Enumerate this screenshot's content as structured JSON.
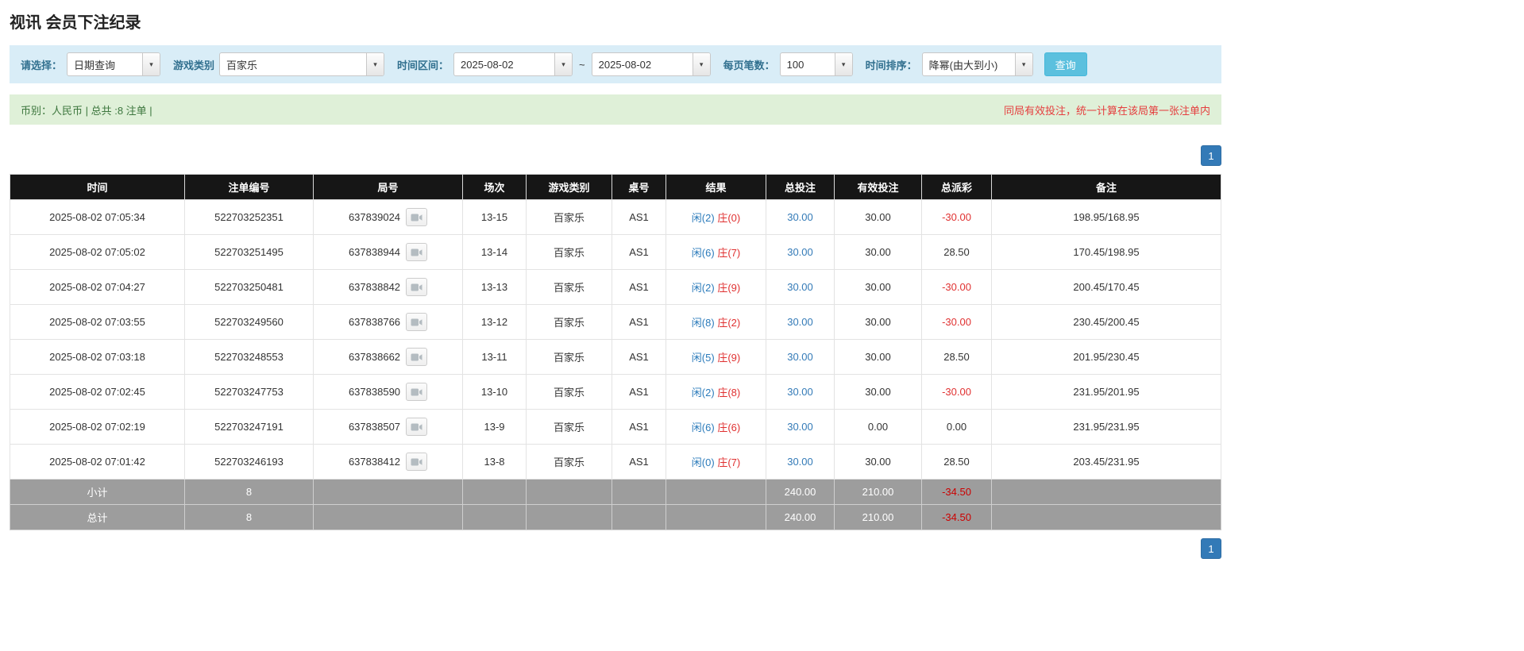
{
  "page": {
    "title": "视讯 会员下注纪录"
  },
  "filters": {
    "select_label": "请选择：",
    "select_value": "日期查询",
    "game_type_label": "游戏类别",
    "game_type_value": "百家乐",
    "time_range_label": "时间区间：",
    "date_from": "2025-08-02",
    "date_separator": "~",
    "date_to": "2025-08-02",
    "page_size_label": "每页笔数：",
    "page_size_value": "100",
    "sort_label": "时间排序：",
    "sort_value": "降幂(由大到小)",
    "search_button_label": "查询"
  },
  "summary": {
    "left_text": "币别：人民币 | 总共 :8 注单 |",
    "right_text": "同局有效投注，统一计算在该局第一张注单内"
  },
  "pagination": {
    "page_label": "1"
  },
  "table": {
    "headers": [
      "时间",
      "注单编号",
      "局号",
      "场次",
      "游戏类别",
      "桌号",
      "结果",
      "总投注",
      "有效投注",
      "总派彩",
      "备注"
    ],
    "rows": [
      {
        "time": "2025-08-02 07:05:34",
        "bet_id": "522703252351",
        "round_id": "637839024",
        "session": "13-15",
        "game": "百家乐",
        "table_no": "AS1",
        "result_player": "闲(2)",
        "result_banker": "庄(0)",
        "total_bet": "30.00",
        "valid_bet": "30.00",
        "payout": "-30.00",
        "note": "198.95/168.95"
      },
      {
        "time": "2025-08-02 07:05:02",
        "bet_id": "522703251495",
        "round_id": "637838944",
        "session": "13-14",
        "game": "百家乐",
        "table_no": "AS1",
        "result_player": "闲(6)",
        "result_banker": "庄(7)",
        "total_bet": "30.00",
        "valid_bet": "30.00",
        "payout": "28.50",
        "note": "170.45/198.95"
      },
      {
        "time": "2025-08-02 07:04:27",
        "bet_id": "522703250481",
        "round_id": "637838842",
        "session": "13-13",
        "game": "百家乐",
        "table_no": "AS1",
        "result_player": "闲(2)",
        "result_banker": "庄(9)",
        "total_bet": "30.00",
        "valid_bet": "30.00",
        "payout": "-30.00",
        "note": "200.45/170.45"
      },
      {
        "time": "2025-08-02 07:03:55",
        "bet_id": "522703249560",
        "round_id": "637838766",
        "session": "13-12",
        "game": "百家乐",
        "table_no": "AS1",
        "result_player": "闲(8)",
        "result_banker": "庄(2)",
        "total_bet": "30.00",
        "valid_bet": "30.00",
        "payout": "-30.00",
        "note": "230.45/200.45"
      },
      {
        "time": "2025-08-02 07:03:18",
        "bet_id": "522703248553",
        "round_id": "637838662",
        "session": "13-11",
        "game": "百家乐",
        "table_no": "AS1",
        "result_player": "闲(5)",
        "result_banker": "庄(9)",
        "total_bet": "30.00",
        "valid_bet": "30.00",
        "payout": "28.50",
        "note": "201.95/230.45"
      },
      {
        "time": "2025-08-02 07:02:45",
        "bet_id": "522703247753",
        "round_id": "637838590",
        "session": "13-10",
        "game": "百家乐",
        "table_no": "AS1",
        "result_player": "闲(2)",
        "result_banker": "庄(8)",
        "total_bet": "30.00",
        "valid_bet": "30.00",
        "payout": "-30.00",
        "note": "231.95/201.95"
      },
      {
        "time": "2025-08-02 07:02:19",
        "bet_id": "522703247191",
        "round_id": "637838507",
        "session": "13-9",
        "game": "百家乐",
        "table_no": "AS1",
        "result_player": "闲(6)",
        "result_banker": "庄(6)",
        "total_bet": "30.00",
        "valid_bet": "0.00",
        "payout": "0.00",
        "note": "231.95/231.95"
      },
      {
        "time": "2025-08-02 07:01:42",
        "bet_id": "522703246193",
        "round_id": "637838412",
        "session": "13-8",
        "game": "百家乐",
        "table_no": "AS1",
        "result_player": "闲(0)",
        "result_banker": "庄(7)",
        "total_bet": "30.00",
        "valid_bet": "30.00",
        "payout": "28.50",
        "note": "203.45/231.95"
      }
    ],
    "subtotal": {
      "label": "小计",
      "count": "8",
      "total_bet": "240.00",
      "valid_bet": "210.00",
      "payout": "-34.50"
    },
    "total": {
      "label": "总计",
      "count": "8",
      "total_bet": "240.00",
      "valid_bet": "210.00",
      "payout": "-34.50"
    }
  },
  "colors": {
    "accent_blue": "#337ab7",
    "player_blue": "#2b7bbb",
    "banker_red": "#e03131",
    "negative_red": "#e03131",
    "footer_negative_red": "#cc0000",
    "header_black": "#161616",
    "filter_bar_bg": "#d9edf7",
    "summary_bar_bg": "#dff0d8",
    "search_button_bg": "#5bc0de",
    "footer_row_bg": "#9d9d9d"
  }
}
